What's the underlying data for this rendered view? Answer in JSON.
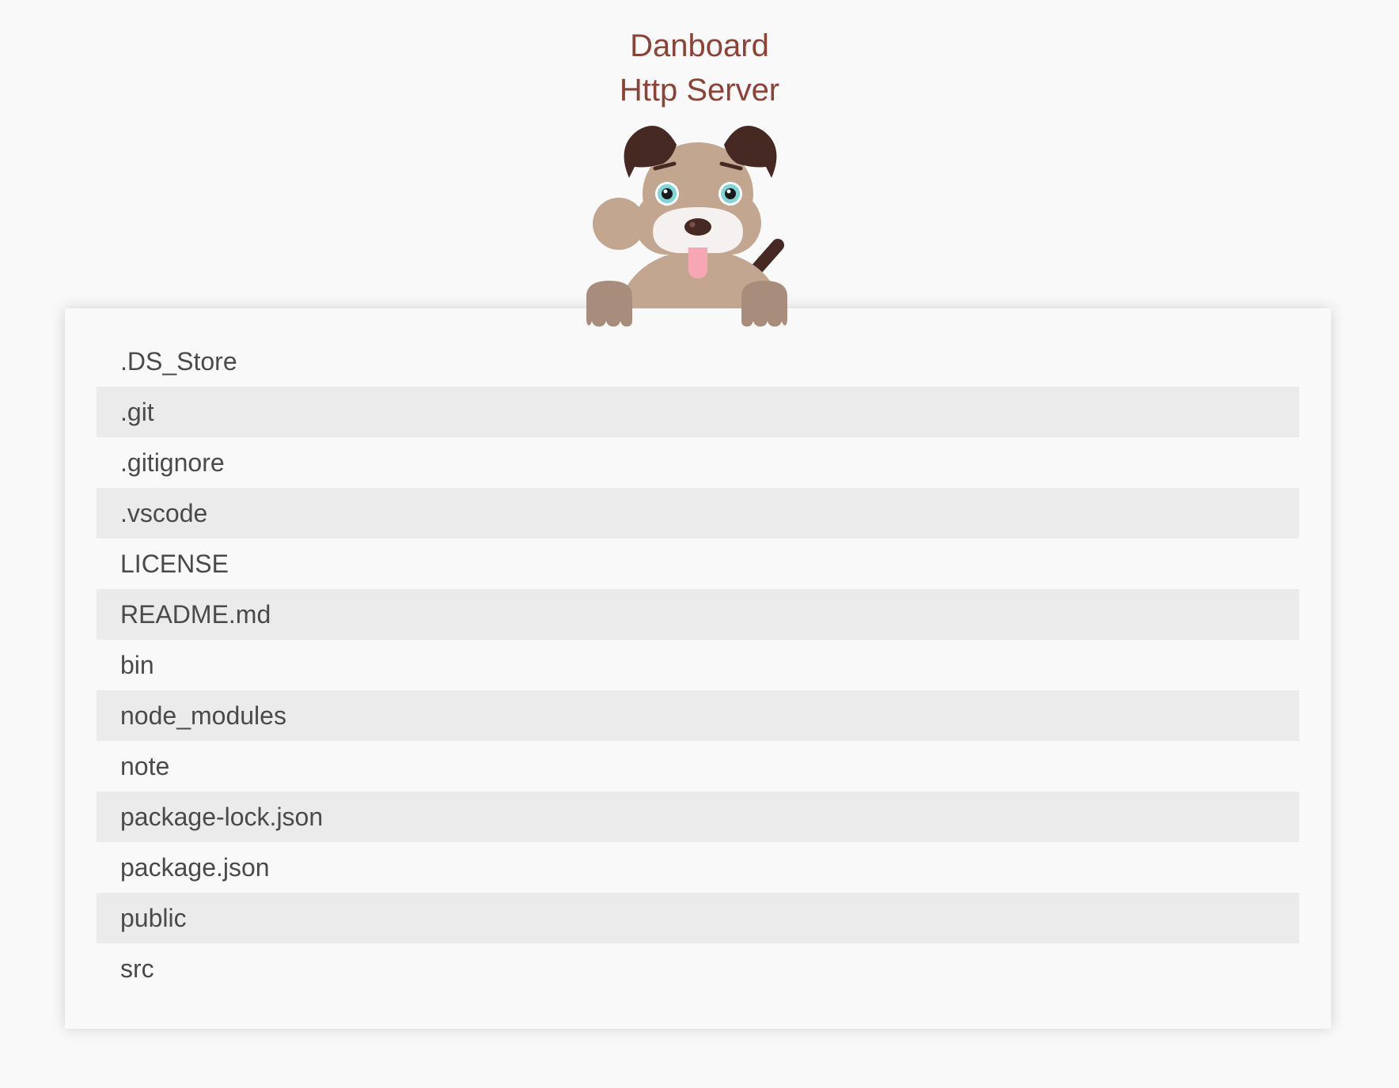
{
  "header": {
    "title_line1": "Danboard",
    "title_line2": "Http Server"
  },
  "mascot": {
    "icon": "dog-mascot-icon"
  },
  "colors": {
    "title": "#8e4236",
    "background": "#f9f9f9",
    "row_alt": "#ebebeb",
    "text": "#4a4a4a",
    "dog_body": "#c2a690",
    "dog_ears": "#472923",
    "dog_tongue": "#f7a6b4"
  },
  "files": [
    ".DS_Store",
    ".git",
    ".gitignore",
    ".vscode",
    "LICENSE",
    "README.md",
    "bin",
    "node_modules",
    "note",
    "package-lock.json",
    "package.json",
    "public",
    "src"
  ]
}
